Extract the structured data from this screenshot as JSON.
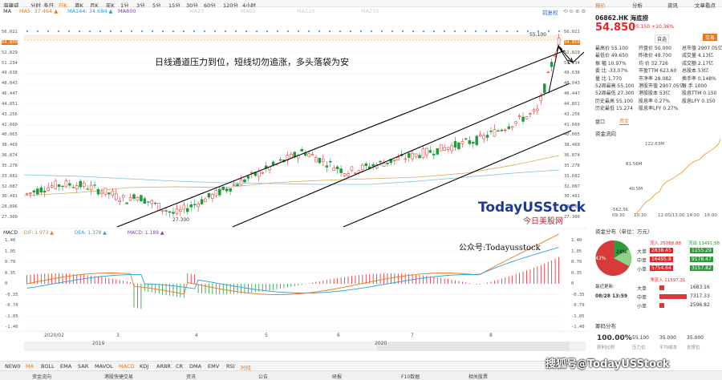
{
  "top_tabs": [
    "海康威",
    "分时",
    "多日",
    "日K",
    "周K",
    "月K",
    "年K",
    "1分",
    "3分",
    "5分",
    "15分",
    "30分",
    "60分",
    "120分",
    "4小时"
  ],
  "toolbar": {
    "ma": "MA",
    "ma5": "MA5: 37.464 ▲",
    "ma144": "MA144: 34.684 ▲",
    "ma800": "MA800",
    "fq": "前复权",
    "row1_hidden": [
      "MA20",
      "MA60",
      "MA120",
      "MA250"
    ]
  },
  "right_tabs": [
    "报价",
    "分析",
    "资讯",
    "文章看点"
  ],
  "price_axis": [
    "56.021",
    "54.850",
    "52.829",
    "51.234",
    "49.638",
    "48.043",
    "46.447",
    "44.851",
    "43.256",
    "41.660",
    "40.065",
    "38.469",
    "36.874",
    "35.278",
    "33.682",
    "32.087",
    "30.491",
    "28.896",
    "27.300"
  ],
  "annotations": {
    "headline": "日线通道压力到位，短线切勿追涨，多头落袋为安",
    "high_label": "55.100",
    "low_label": "27.300",
    "watermark_main": "TodayUSStock",
    "watermark_sub": "今日美股网",
    "wechat": "公众号:Todayusstock"
  },
  "macd": {
    "dif": "DIF: 1.973 ▲",
    "dea": "DEA: 1.378 ▲",
    "macd": "MACD: 1.189 ▲",
    "axis": [
      "1.40",
      "1.05",
      "0.70",
      "0.35",
      "0",
      "-0.35",
      "-0.70",
      "-1.05",
      "-1.40"
    ],
    "axis_right": [
      "1.40",
      "1.05",
      "0.70",
      "0.35",
      "0",
      "-0.35",
      "-0.70",
      "-1.05",
      "-1.40"
    ]
  },
  "x_axis": [
    "2020/02",
    "3",
    "4",
    "5",
    "6",
    "7",
    "8"
  ],
  "year_labels": [
    "2019",
    "2020"
  ],
  "indicator_tabs": [
    "NEW0",
    "MA",
    "BOLL",
    "EMA",
    "SAR",
    "MAVOL",
    "MACD",
    "KDJ",
    "ARBR",
    "CR",
    "DMA",
    "EMV",
    "RSI",
    "时段"
  ],
  "bottom_bar": [
    "资金流向",
    "港股快捷交易",
    "资讯",
    "公告",
    "研报",
    "F10数据",
    "相关股票"
  ],
  "quote": {
    "code_name": "06862.HK 海底捞",
    "price": "54.850",
    "change": "+5.150 +10.36%",
    "follow": "自选",
    "trade": "交易",
    "rows": [
      [
        "最高价 55.100",
        "开盘价 50.000",
        "总市值 2907.05亿"
      ],
      [
        "最低价 49.650",
        "昨收价 49.700",
        "成交量 4.13亿"
      ],
      [
        "振 幅 10.97%",
        "均 价 52.726",
        "成交额 2.17亿"
      ],
      [
        "委 比 -33.07%",
        "市盈TTM 623.60",
        "总股本 53亿"
      ],
      [
        "量 比 1.770",
        "市净率 28.082",
        "换手率 0.148%"
      ],
      [
        "52周最高 55.100",
        "港股市值 2907.05亿",
        "每 手 1000"
      ],
      [
        "52周最低 27.300",
        "港股股本 53亿",
        "股息TTM 0.150"
      ],
      [
        "历史最高 55.100",
        "股息率 0.27%",
        "股息LFY 0.150"
      ],
      [
        "历史最低 15.274",
        "股息率LFY 0.27%",
        ""
      ]
    ],
    "panel_tabs": [
      "盘口",
      "资金"
    ],
    "fund_title": "资金流向",
    "fund_axis": [
      "122.63M",
      "81.56M",
      "40.5M",
      "-562.5K"
    ],
    "fund_times": [
      "09:30",
      "10:30",
      "12:00/13:00",
      "14:00",
      "16:00"
    ],
    "dist_title": "资金分布（单位：万元）",
    "inflow_label": "流入 25088.88",
    "outflow_label": "流出 13491.58",
    "pie_pct_red": "43%",
    "pie_pct_green": "24%",
    "dist_rows": [
      [
        "大单",
        "2838.45",
        "1155.29"
      ],
      [
        "中单",
        "16495.8",
        "9178.47"
      ],
      [
        "小单",
        "5754.64",
        "3157.82"
      ]
    ],
    "net_title": "净流入 11597.31",
    "recent_title": "最近更新:",
    "recent_time": "08/28 13:59",
    "net_rows": [
      [
        "大单",
        "1683.16"
      ],
      [
        "中单",
        "7317.33"
      ],
      [
        "小单",
        "2596.82"
      ]
    ],
    "chip_title": "筹码分布",
    "chip_vals": [
      "100.00%",
      "55.100",
      "35.000",
      "35.000"
    ],
    "chip_labels": [
      "获利比例",
      "压力位",
      "平均成本",
      "支撑位"
    ],
    "sohu": "搜狐号@TodayUSStock"
  },
  "colors": {
    "up": "#e5252a",
    "down": "#1f9a3a",
    "accent": "#e8791b",
    "line": "#000000"
  }
}
